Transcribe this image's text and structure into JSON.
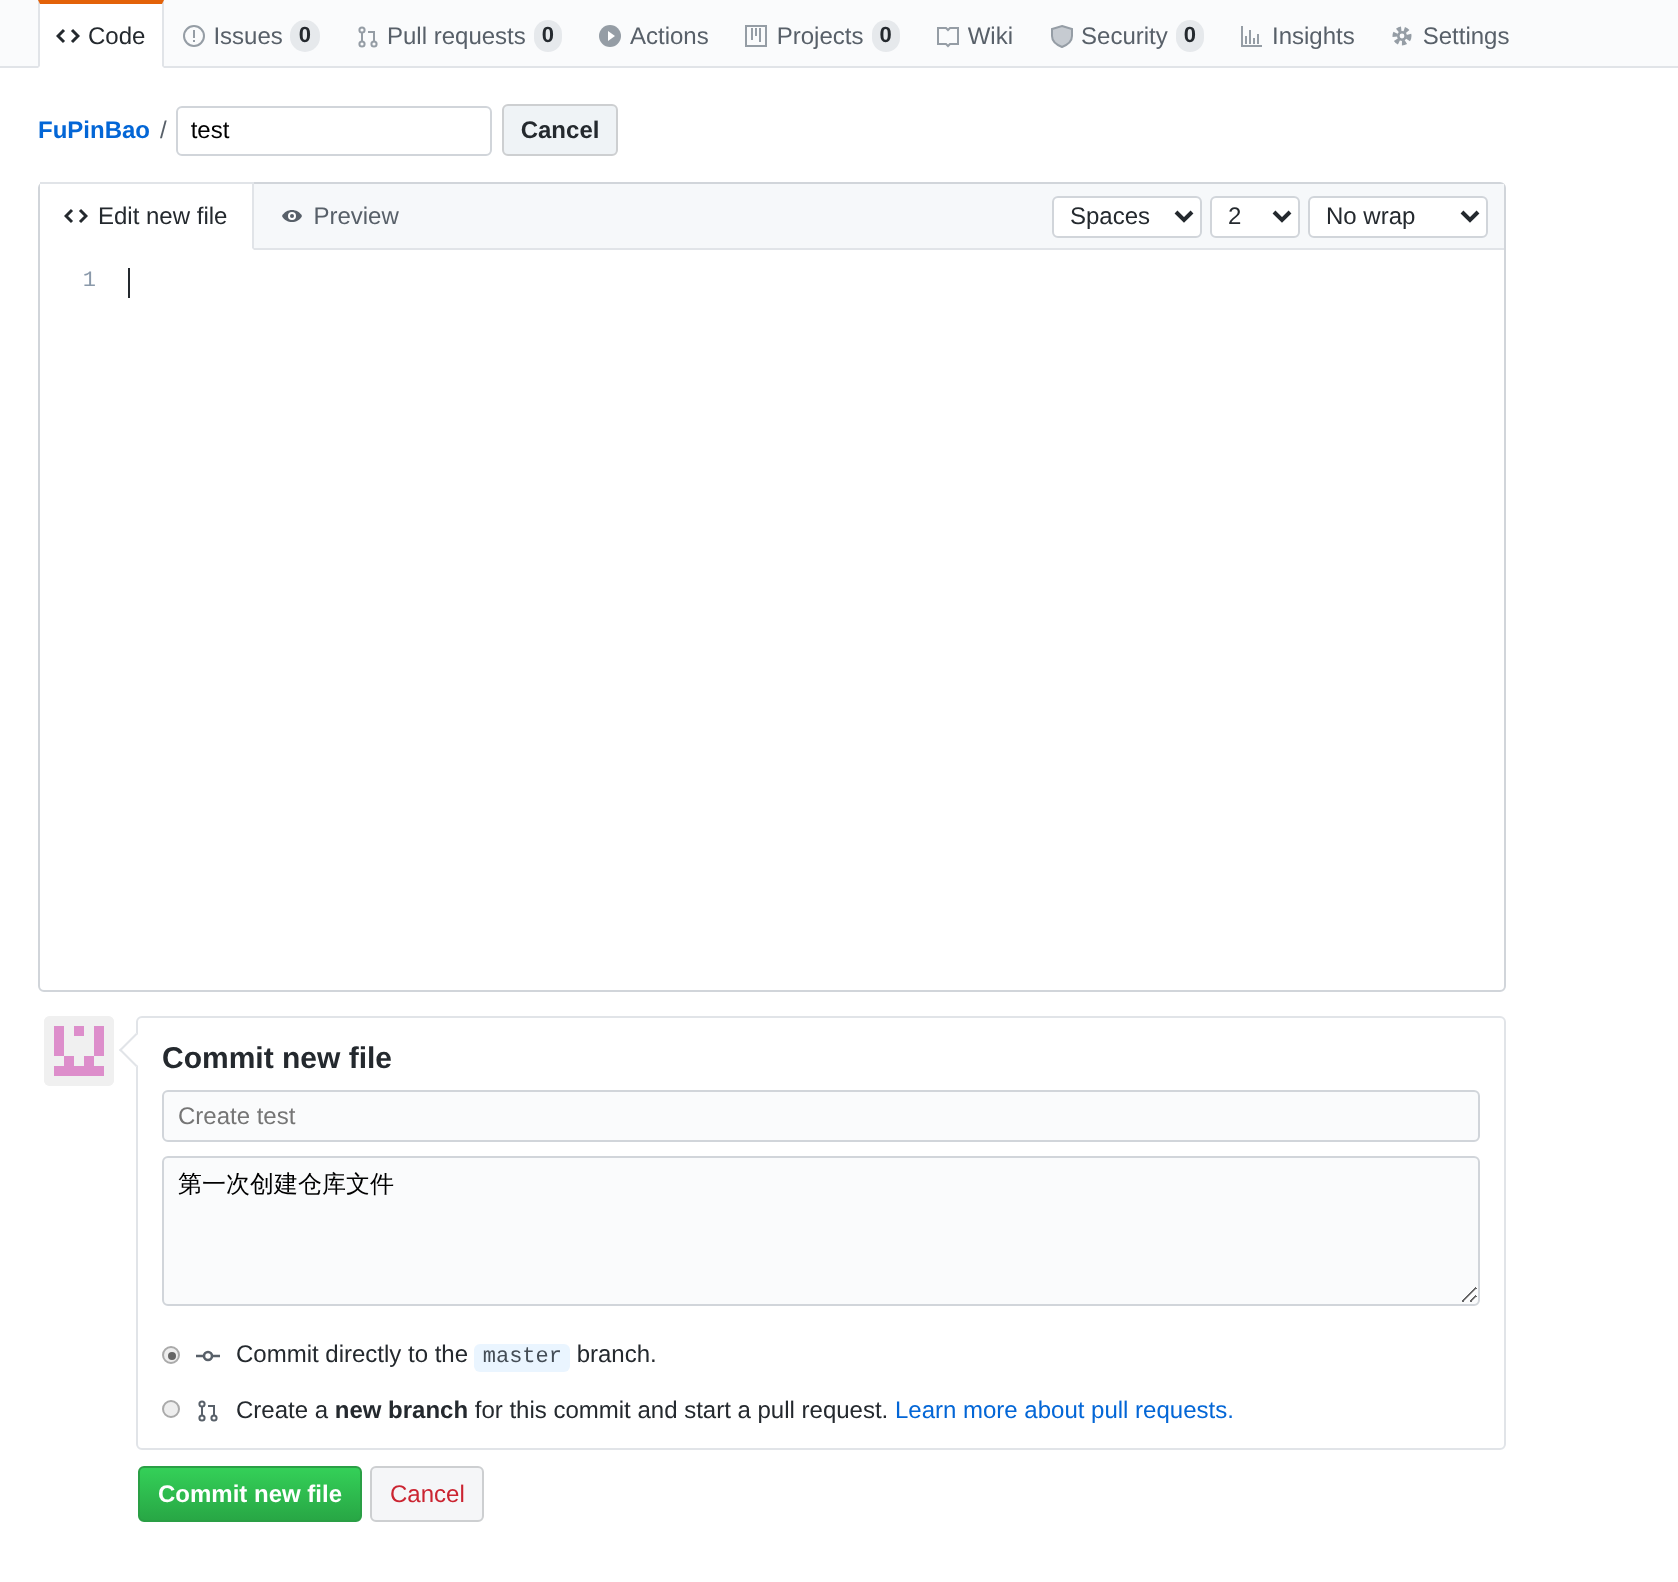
{
  "tabs": [
    {
      "label": "Code",
      "selected": true
    },
    {
      "label": "Issues",
      "count": "0",
      "selected": false
    },
    {
      "label": "Pull requests",
      "count": "0",
      "selected": false
    },
    {
      "label": "Actions",
      "selected": false
    },
    {
      "label": "Projects",
      "count": "0",
      "selected": false
    },
    {
      "label": "Wiki",
      "selected": false
    },
    {
      "label": "Security",
      "count": "0",
      "selected": false
    },
    {
      "label": "Insights",
      "selected": false
    },
    {
      "label": "Settings",
      "selected": false
    }
  ],
  "breadcrumb": {
    "repo": "FuPinBao",
    "separator": "/",
    "filename": "test",
    "cancel": "Cancel"
  },
  "editor": {
    "tabs": [
      {
        "label": "Edit new file",
        "selected": true
      },
      {
        "label": "Preview",
        "selected": false
      }
    ],
    "options": [
      "Spaces",
      "2",
      "No wrap"
    ],
    "line_numbers": [
      "1"
    ]
  },
  "commit": {
    "title": "Commit new file",
    "summary_placeholder": "Create test",
    "description": "第一次创建仓库文件",
    "choices": [
      {
        "kind": "direct",
        "text": "Commit directly to the",
        "branch": "master",
        "text_after": "branch.",
        "selected": true
      },
      {
        "kind": "new_branch",
        "text": "Create a **new branch** for this commit and start a pull request.",
        "link": "Learn more about pull requests.",
        "selected": false
      }
    ],
    "submit": "Commit new file",
    "cancel": "Cancel"
  }
}
